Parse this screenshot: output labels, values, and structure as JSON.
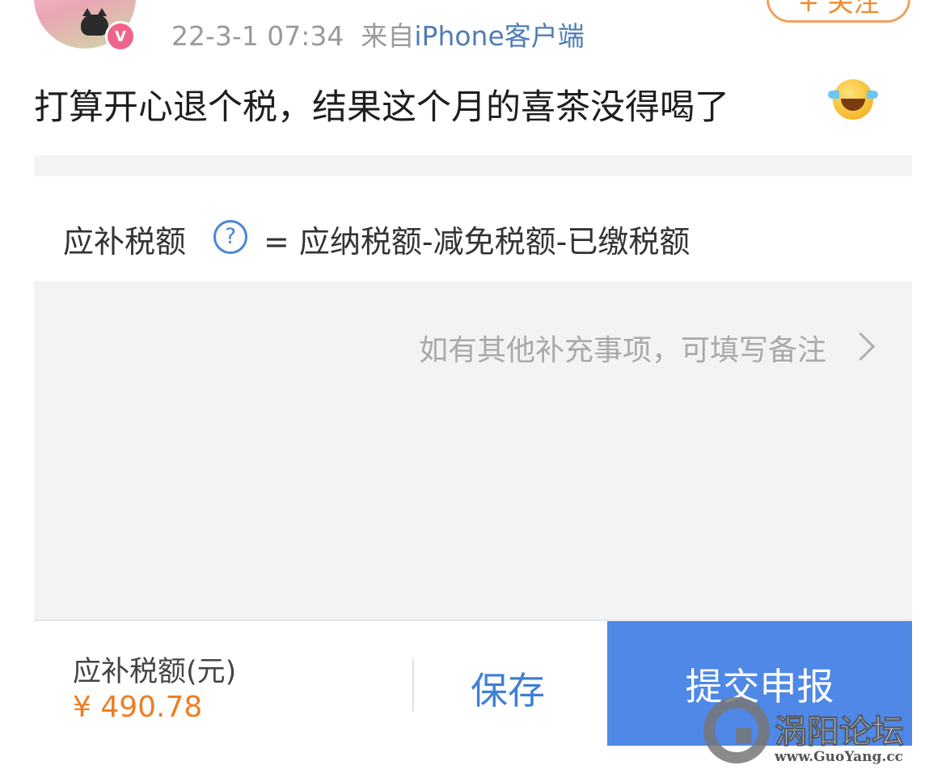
{
  "post": {
    "timestamp": "22-3-1 07:34",
    "source_prefix": "来自",
    "source_name": "iPhone客户端",
    "follow_label": "+ 关注",
    "text": "打算开心退个税，结果这个月的喜茶没得喝了",
    "emoji": "laughing-tears"
  },
  "screenshot": {
    "formula_label": "应补税额",
    "formula_expression": "= 应纳税额-减免税额-已缴税额",
    "note_link": "如有其他补充事项，可填写备注",
    "due_label": "应补税额(元)",
    "due_amount": "¥ 490.78",
    "save_label": "保存",
    "submit_label": "提交申报"
  },
  "watermark": {
    "title": "涡阳论坛",
    "url": "www.GuoYang.cc"
  },
  "colors": {
    "accent_blue": "#4f88e6",
    "amount_orange": "#ef7d22",
    "follow_orange": "#f08a2c",
    "source_blue": "#4f7db8"
  }
}
